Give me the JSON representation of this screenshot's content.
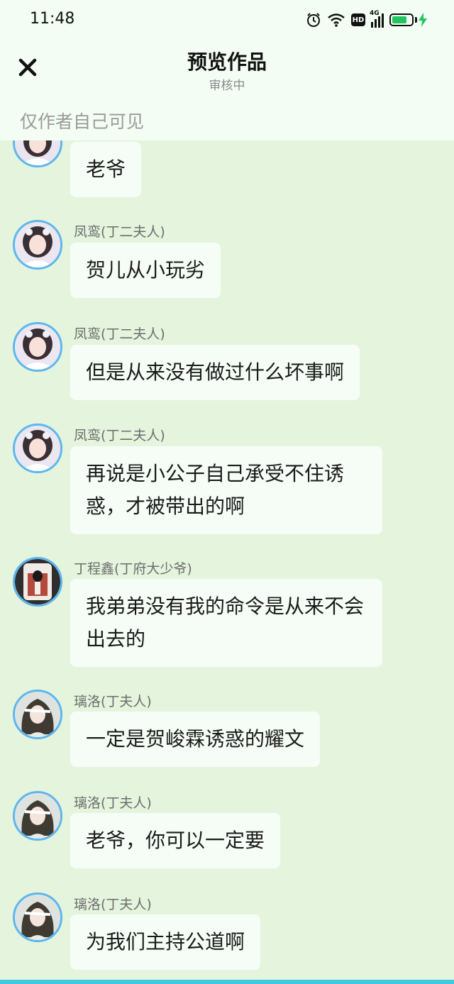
{
  "status_bar": {
    "time": "11:48",
    "hd_label": "HD",
    "network_label": "4G",
    "battery_color": "#22c55e"
  },
  "header": {
    "title": "预览作品",
    "subtitle": "审核中",
    "visibility_note": "仅作者自己可见",
    "close_icon": "close-icon"
  },
  "messages": [
    {
      "sender": "",
      "avatar": "fengluan",
      "text": "老爷"
    },
    {
      "sender": "凤鸾(丁二夫人)",
      "avatar": "fengluan",
      "text": "贺儿从小玩劣"
    },
    {
      "sender": "凤鸾(丁二夫人)",
      "avatar": "fengluan",
      "text": "但是从来没有做过什么坏事啊"
    },
    {
      "sender": "凤鸾(丁二夫人)",
      "avatar": "fengluan",
      "text": "再说是小公子自己承受不住诱惑，才被带出的啊"
    },
    {
      "sender": "丁程鑫(丁府大少爷)",
      "avatar": "dingchengxin",
      "text": "我弟弟没有我的命令是从来不会出去的"
    },
    {
      "sender": "璃洛(丁夫人)",
      "avatar": "liluo",
      "text": "一定是贺峻霖诱惑的耀文"
    },
    {
      "sender": "璃洛(丁夫人)",
      "avatar": "liluo",
      "text": "老爷，你可以一定要"
    },
    {
      "sender": "璃洛(丁夫人)",
      "avatar": "liluo",
      "text": "为我们主持公道啊"
    }
  ],
  "colors": {
    "header_bg": "#f3fdf4",
    "chat_bg": "#e4f4dd",
    "bubble_bg": "#f6fdf7",
    "avatar_ring": "#5cb6ef",
    "bottom_accent": "#40c9dc"
  }
}
